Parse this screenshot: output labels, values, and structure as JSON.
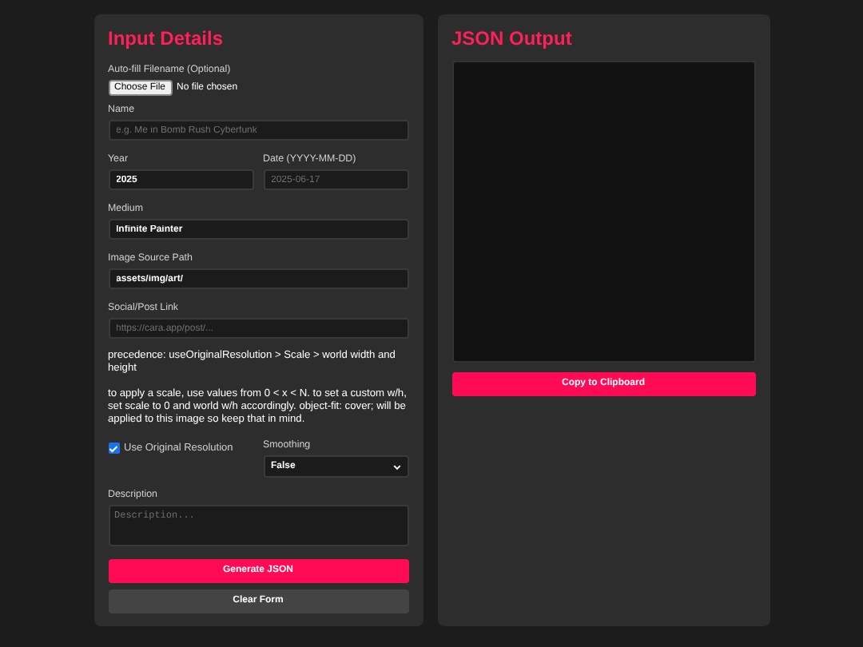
{
  "input_panel": {
    "title": "Input Details",
    "file": {
      "label": "Auto-fill Filename (Optional)",
      "button": "Choose File",
      "status": "No file chosen"
    },
    "name": {
      "label": "Name",
      "placeholder": "e.g. Me in Bomb Rush Cyberfunk"
    },
    "year": {
      "label": "Year",
      "value": "2025"
    },
    "date": {
      "label": "Date (YYYY-MM-DD)",
      "placeholder": "2025-06-17"
    },
    "medium": {
      "label": "Medium",
      "value": "Infinite Painter"
    },
    "image_source": {
      "label": "Image Source Path",
      "value": "assets/img/art/"
    },
    "social": {
      "label": "Social/Post Link",
      "placeholder": "https://cara.app/post/..."
    },
    "notes": [
      "precedence: useOriginalResolution > Scale > world width and height",
      "to apply a scale, use values from 0 < x < N. to set a custom w/h, set scale to 0 and world w/h accordingly. object-fit: cover; will be applied to this image so keep that in mind."
    ],
    "use_original": {
      "label": "Use Original Resolution",
      "checked": true
    },
    "smoothing": {
      "label": "Smoothing",
      "value": "False"
    },
    "description": {
      "label": "Description",
      "placeholder": "Description..."
    },
    "buttons": [
      {
        "label": "Generate JSON",
        "kind": "primary"
      },
      {
        "label": "Clear Form",
        "kind": "secondary"
      }
    ]
  },
  "output_panel": {
    "title": "JSON Output",
    "button": "Copy to Clipboard"
  }
}
